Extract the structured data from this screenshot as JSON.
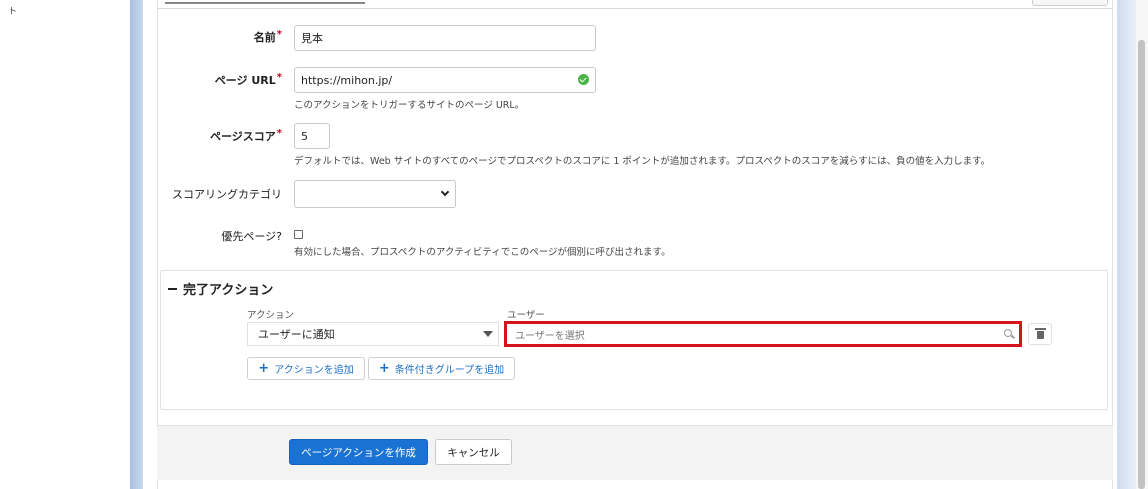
{
  "left_stub_text": "ト",
  "form": {
    "name": {
      "label": "名前",
      "required_mark": "*",
      "value": "見本"
    },
    "page_url": {
      "label": "ページ URL",
      "required_mark": "*",
      "value": "https://mihon.jp/",
      "help": "このアクションをトリガーするサイトのページ URL。",
      "status_icon": "check-circle-icon"
    },
    "page_score": {
      "label": "ページスコア",
      "required_mark": "*",
      "value": "5",
      "help": "デフォルトでは、Web サイトのすべてのページでプロスペクトのスコアに 1 ポイントが追加されます。プロスペクトのスコアを減らすには、負の値を入力します。"
    },
    "scoring_category": {
      "label": "スコアリングカテゴリ",
      "value": ""
    },
    "priority_page": {
      "label": "優先ページ?",
      "checked": false,
      "help": "有効にした場合、プロスペクトのアクティビティでこのページが個別に呼び出されます。"
    }
  },
  "completion_actions": {
    "title": "完了アクション",
    "action_col_label": "アクション",
    "user_col_label": "ユーザー",
    "action_value": "ユーザーに通知",
    "user_placeholder": "ユーザーを選択",
    "add_action_label": "アクションを追加",
    "add_group_label": "条件付きグループを追加"
  },
  "footer": {
    "create_label": "ページアクションを作成",
    "cancel_label": "キャンセル"
  },
  "colors": {
    "primary": "#1a73d4",
    "highlight": "#d4141a",
    "success": "#4bb347",
    "required": "#d0021b"
  }
}
